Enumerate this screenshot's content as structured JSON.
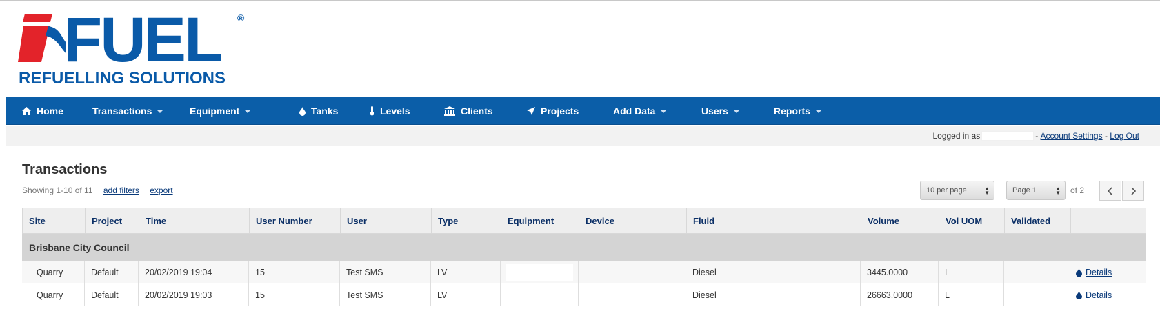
{
  "brand": {
    "name": "FUEL",
    "tagline": "REFUELLING SOLUTIONS",
    "registered": "®",
    "colors": {
      "blue": "#0a5aa8",
      "red": "#e3232a"
    }
  },
  "nav": {
    "items": [
      {
        "label": "Home",
        "icon": "home-icon",
        "dropdown": false
      },
      {
        "label": "Transactions",
        "icon": "",
        "dropdown": true
      },
      {
        "label": "Equipment",
        "icon": "",
        "dropdown": true
      },
      {
        "label": "Tanks",
        "icon": "drop-icon",
        "dropdown": false
      },
      {
        "label": "Levels",
        "icon": "thermometer-icon",
        "dropdown": false
      },
      {
        "label": "Clients",
        "icon": "bank-icon",
        "dropdown": false
      },
      {
        "label": "Projects",
        "icon": "location-arrow-icon",
        "dropdown": false
      },
      {
        "label": "Add Data",
        "icon": "",
        "dropdown": true
      },
      {
        "label": "Users",
        "icon": "",
        "dropdown": true
      },
      {
        "label": "Reports",
        "icon": "",
        "dropdown": true
      }
    ],
    "color": "#0b5ea8"
  },
  "login": {
    "prefix": "Logged in as",
    "separator1": "-",
    "account_settings": "Account Settings",
    "separator2": "-",
    "logout": "Log Out"
  },
  "page": {
    "title": "Transactions",
    "showing": "Showing 1-10 of 11",
    "add_filters": "add filters",
    "export": "export",
    "per_page": "10 per page",
    "page_select": "Page 1",
    "of_pages": "of 2"
  },
  "table": {
    "columns": [
      "Site",
      "Project",
      "Time",
      "User Number",
      "User",
      "Type",
      "Equipment",
      "Device",
      "Fluid",
      "Volume",
      "Vol UOM",
      "Validated",
      ""
    ],
    "group": "Brisbane City Council",
    "rows": [
      {
        "site": "Quarry",
        "project": "Default",
        "time": "20/02/2019 19:04",
        "user_number": "15",
        "user": "Test SMS",
        "type": "LV",
        "equipment": "",
        "device": "",
        "fluid": "Diesel",
        "volume": "3445.0000",
        "vol_uom": "L",
        "validated": "",
        "action": "Details"
      },
      {
        "site": "Quarry",
        "project": "Default",
        "time": "20/02/2019 19:03",
        "user_number": "15",
        "user": "Test SMS",
        "type": "LV",
        "equipment": "",
        "device": "",
        "fluid": "Diesel",
        "volume": "26663.0000",
        "vol_uom": "L",
        "validated": "",
        "action": "Details"
      }
    ]
  }
}
